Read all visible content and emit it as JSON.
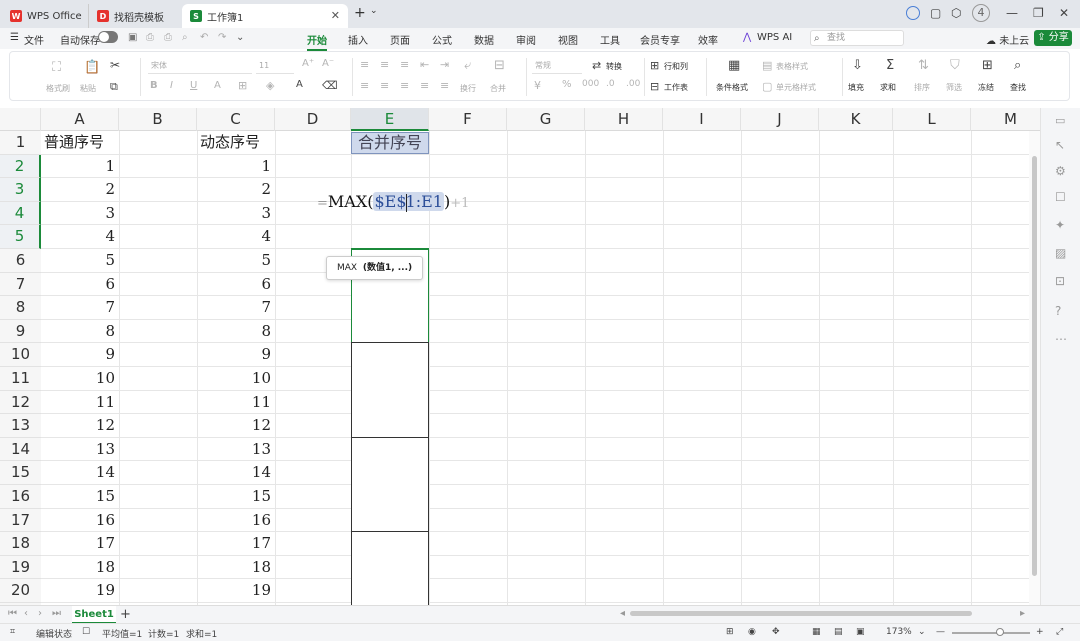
{
  "titlebar": {
    "tabs": [
      {
        "label": "WPS Office",
        "icon": "wps-logo-icon",
        "color": "#e5322d"
      },
      {
        "label": "找稻壳模板",
        "icon": "docer-icon",
        "color": "#e5322d"
      },
      {
        "label": "工作簿1",
        "icon": "spreadsheet-icon",
        "color": "#1b8a3a"
      }
    ],
    "badge": "4"
  },
  "menubar": {
    "file": "文件",
    "autosave": "自动保存",
    "tabs": [
      "开始",
      "插入",
      "页面",
      "公式",
      "数据",
      "审阅",
      "视图",
      "工具",
      "会员专享",
      "效率",
      "WPS AI"
    ],
    "active_tab": "开始",
    "search_placeholder": "查找",
    "cloud": "未上云",
    "share": "分享"
  },
  "ribbon": {
    "format_painter": "格式刷",
    "paste": "粘贴",
    "font_name": "宋体",
    "font_size": "11",
    "number_format": "常规",
    "convert": "转换",
    "wrap": "换行",
    "merge": "合并",
    "row_col": "行和列",
    "worksheet": "工作表",
    "cond_format": "条件格式",
    "table_style": "表格样式",
    "cell_style": "单元格样式",
    "fill": "填充",
    "sum": "求和",
    "sort": "排序",
    "filter": "筛选",
    "freeze": "冻结",
    "find": "查找"
  },
  "sheet": {
    "columns": [
      "A",
      "B",
      "C",
      "D",
      "E",
      "F",
      "G",
      "H",
      "I",
      "J",
      "K",
      "L",
      "M"
    ],
    "selected_column": "E",
    "rows": [
      "1",
      "2",
      "3",
      "4",
      "5",
      "6",
      "7",
      "8",
      "9",
      "10",
      "11",
      "12",
      "13",
      "14",
      "15",
      "16",
      "17",
      "18",
      "19",
      "20"
    ],
    "selected_rows": [
      "2",
      "3",
      "4",
      "5"
    ],
    "header_a": "普通序号",
    "header_c": "动态序号",
    "header_e": "合并序号",
    "col_a_values": [
      "1",
      "2",
      "3",
      "4",
      "5",
      "6",
      "7",
      "8",
      "9",
      "10",
      "11",
      "12",
      "13",
      "14",
      "15",
      "16",
      "17",
      "18",
      "19"
    ],
    "col_c_values": [
      "1",
      "2",
      "3",
      "4",
      "5",
      "6",
      "7",
      "8",
      "9",
      "10",
      "11",
      "12",
      "13",
      "14",
      "15",
      "16",
      "17",
      "18",
      "19"
    ],
    "formula": {
      "eq": "=",
      "func": "MAX(",
      "ref_part1": "$E$",
      "ref_part2": "1:E1",
      "close": ")",
      "suffix": "+1"
    },
    "tooltip_func": "MAX",
    "tooltip_arg": "(数值1, ...)"
  },
  "sheetbar": {
    "sheet_name": "Sheet1",
    "add": "+"
  },
  "statusbar": {
    "mode": "编辑状态",
    "average": "平均值=1",
    "count": "计数=1",
    "sum": "求和=1",
    "zoom": "173%"
  },
  "colors": {
    "accent": "#1b8a3a",
    "selection": "#cfd9ec",
    "ref_text": "#2d4f99"
  }
}
